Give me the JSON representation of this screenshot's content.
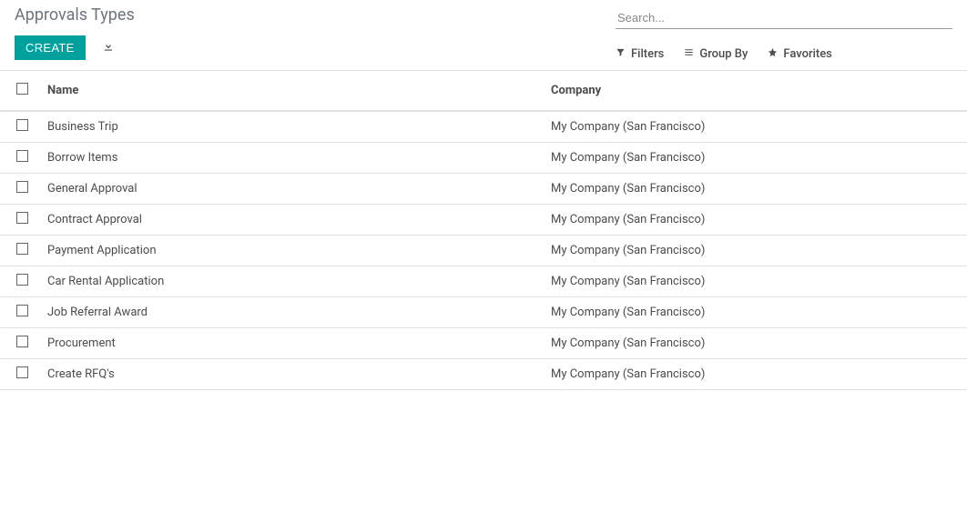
{
  "header": {
    "title": "Approvals Types",
    "create_label": "CREATE"
  },
  "search": {
    "placeholder": "Search...",
    "filters_label": "Filters",
    "groupby_label": "Group By",
    "favorites_label": "Favorites"
  },
  "table": {
    "columns": {
      "name": "Name",
      "company": "Company"
    },
    "rows": [
      {
        "name": "Business Trip",
        "company": "My Company (San Francisco)"
      },
      {
        "name": "Borrow Items",
        "company": "My Company (San Francisco)"
      },
      {
        "name": "General Approval",
        "company": "My Company (San Francisco)"
      },
      {
        "name": "Contract Approval",
        "company": "My Company (San Francisco)"
      },
      {
        "name": "Payment Application",
        "company": "My Company (San Francisco)"
      },
      {
        "name": "Car Rental Application",
        "company": "My Company (San Francisco)"
      },
      {
        "name": "Job Referral Award",
        "company": "My Company (San Francisco)"
      },
      {
        "name": "Procurement",
        "company": "My Company (San Francisco)"
      },
      {
        "name": "Create RFQ's",
        "company": "My Company (San Francisco)"
      }
    ]
  }
}
